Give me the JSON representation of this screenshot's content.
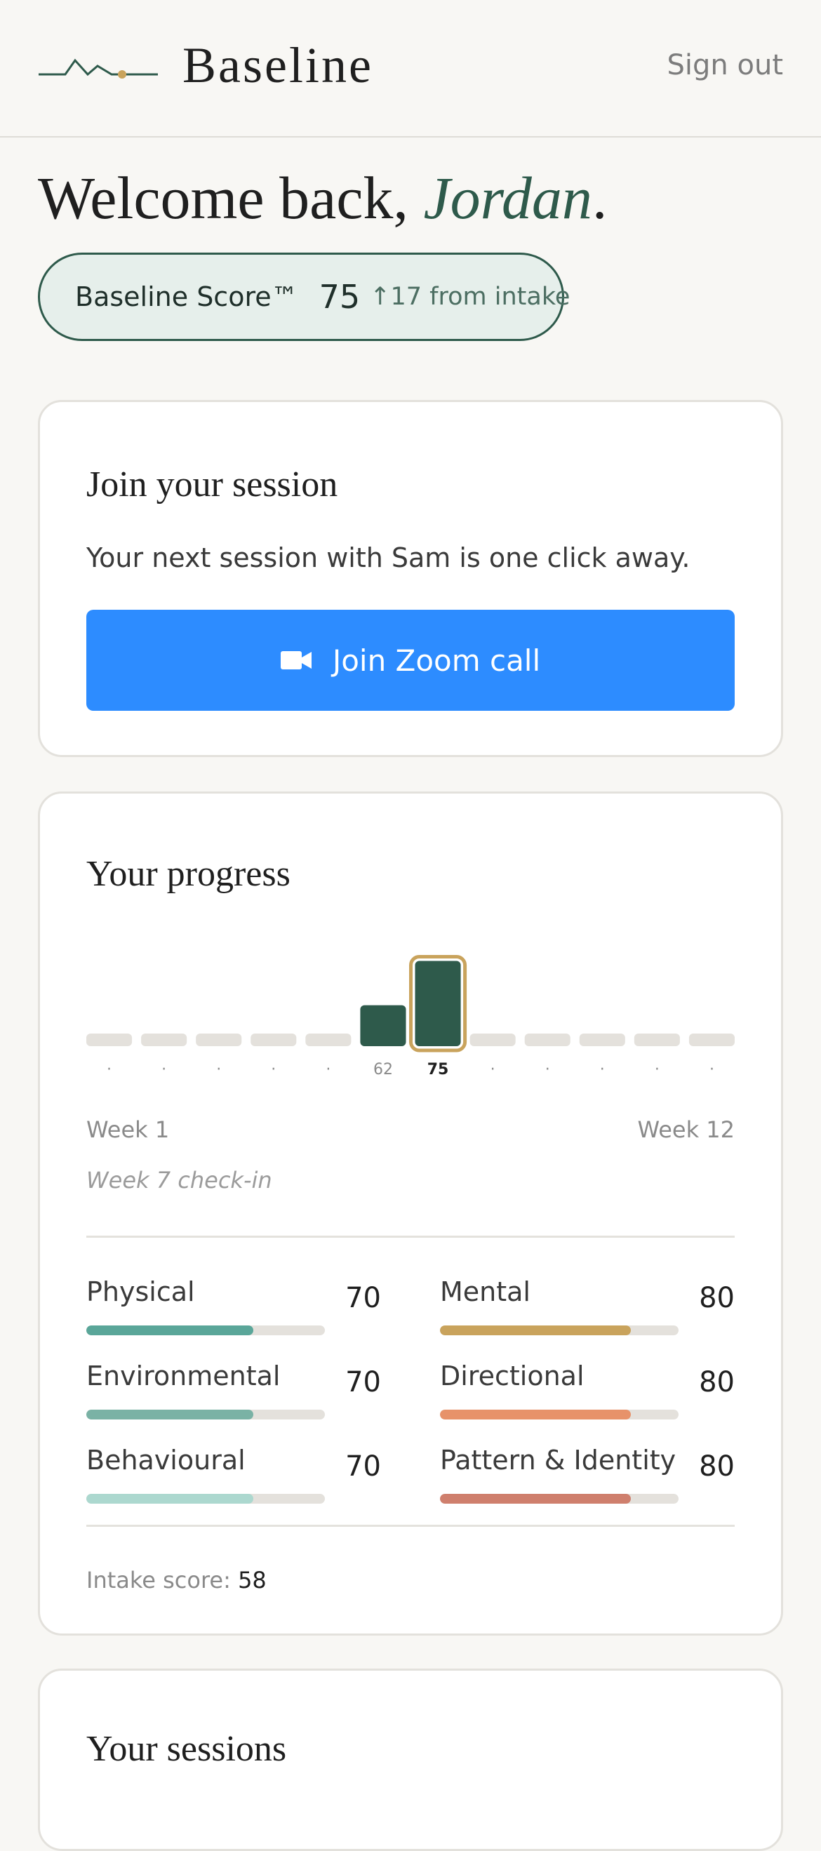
{
  "app": {
    "brand": "Baseline",
    "sign_out": "Sign out"
  },
  "welcome": {
    "greeting": "Welcome back, ",
    "name": "Jordan",
    "punct": "."
  },
  "score": {
    "label": "Baseline Score™",
    "value": "75",
    "delta": "↑17 from intake"
  },
  "session_card": {
    "title": "Join your session",
    "text": "Your next session with Sam is one click away.",
    "button": "Join Zoom call"
  },
  "progress_card": {
    "title": "Your progress",
    "week_start": "Week 1",
    "week_end": "Week 12",
    "checkin": "Week 7 check-in",
    "intake_label": "Intake score: ",
    "intake_value": "58",
    "metrics": [
      {
        "name": "Physical",
        "value": "70",
        "fraction": 0.7,
        "color": "#5aa699"
      },
      {
        "name": "Mental",
        "value": "80",
        "fraction": 0.8,
        "color": "#c9a35c"
      },
      {
        "name": "Environmental",
        "value": "70",
        "fraction": 0.7,
        "color": "#7ab2a5"
      },
      {
        "name": "Directional",
        "value": "80",
        "fraction": 0.8,
        "color": "#e7926a"
      },
      {
        "name": "Behavioural",
        "value": "70",
        "fraction": 0.7,
        "color": "#acd8cf"
      },
      {
        "name": "Pattern & Identity",
        "value": "80",
        "fraction": 0.8,
        "color": "#cf7f6d"
      }
    ]
  },
  "sessions_card": {
    "title": "Your sessions"
  },
  "chart_data": {
    "type": "bar",
    "categories": [
      "1",
      "2",
      "3",
      "4",
      "5",
      "6",
      "7",
      "8",
      "9",
      "10",
      "11",
      "12"
    ],
    "values": [
      null,
      null,
      null,
      null,
      null,
      62,
      75,
      null,
      null,
      null,
      null,
      null
    ],
    "labels": [
      "·",
      "·",
      "·",
      "·",
      "·",
      "62",
      "75",
      "·",
      "·",
      "·",
      "·",
      "·"
    ],
    "highlight_index": 6,
    "ylim": [
      0,
      100
    ],
    "colors": {
      "bar": "#2e5a4b",
      "empty": "#e4e1dc",
      "highlight": "#c9a35c"
    }
  },
  "colors": {
    "accent": "#2e5a4b",
    "zoom": "#2d8cff",
    "gold": "#c9a35c"
  }
}
